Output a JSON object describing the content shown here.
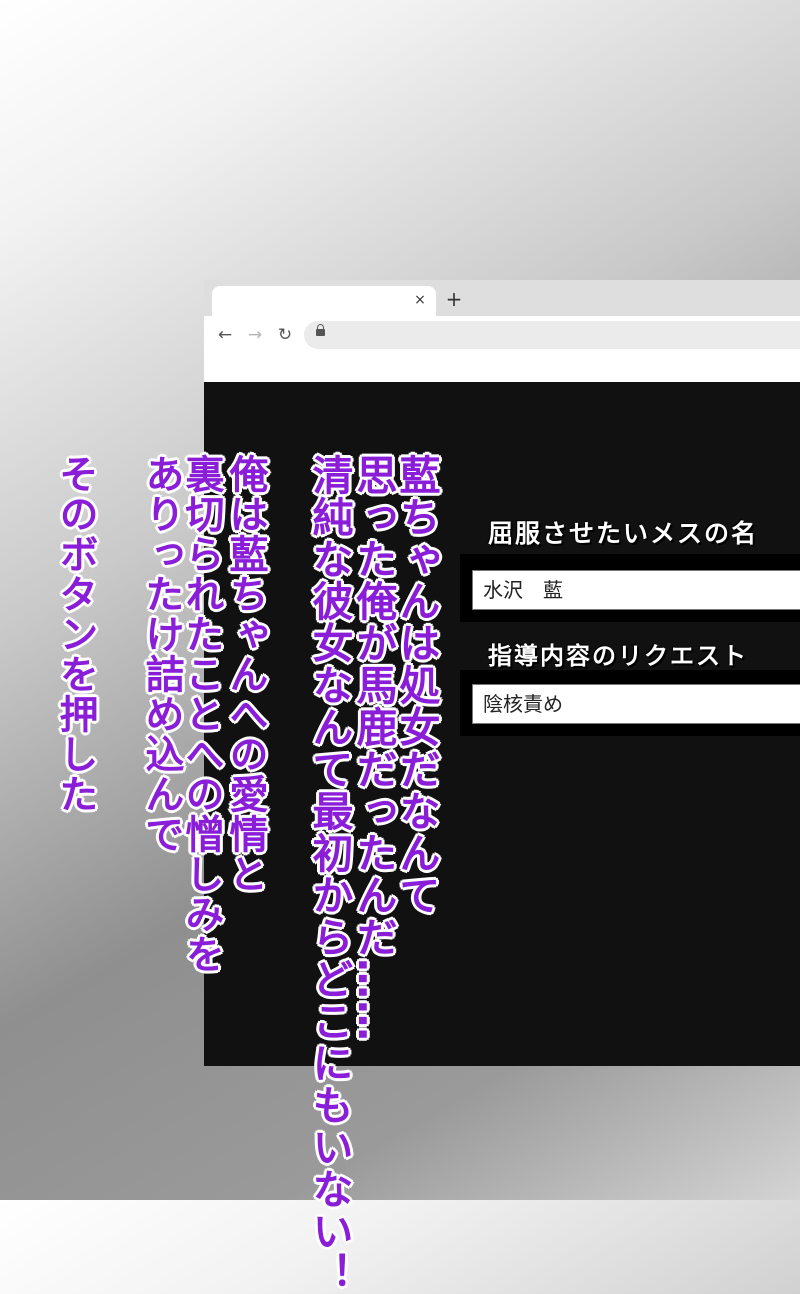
{
  "browser": {
    "tab": {
      "close_icon": "close-icon",
      "close_glyph": "×"
    },
    "new_tab_glyph": "+",
    "nav": {
      "back_glyph": "←",
      "forward_glyph": "→",
      "reload_glyph": "↻"
    }
  },
  "form": {
    "name_label": "屈服させたいメスの名",
    "name_value": "水沢　藍",
    "request_label": "指導内容のリクエスト",
    "request_value": "陰核責め"
  },
  "narration": {
    "col1": "藍ちゃんは処女だなんて",
    "col2": "思った俺が馬鹿だったんだ……",
    "col3": "清純な彼女なんて最初からどこにもいない！",
    "col4": "俺は藍ちゃんへの愛情と",
    "col5": "裏切られたことへの憎しみを",
    "col6": "ありったけ詰め込んで",
    "col7": "そのボタンを押した"
  },
  "colors": {
    "narration_text": "#8a1ed8",
    "page_background": "#111111"
  }
}
